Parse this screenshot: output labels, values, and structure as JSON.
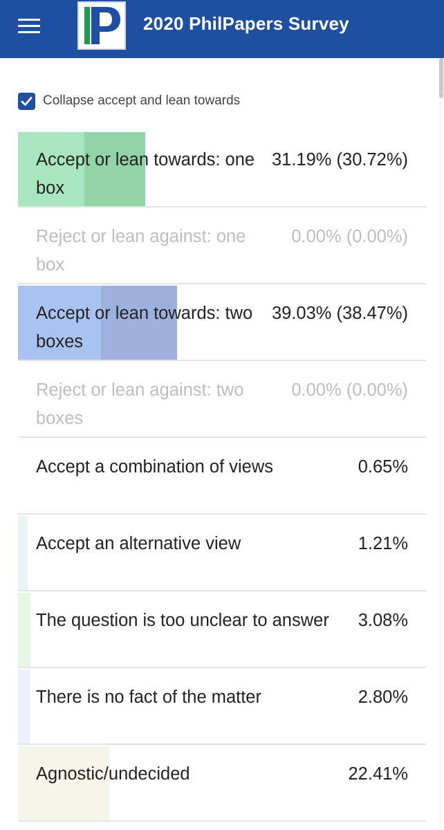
{
  "header": {
    "title": "2020 PhilPapers Survey",
    "logo_letter": "P",
    "background": "#1f4fa0"
  },
  "collapse": {
    "checked": true,
    "label": "Collapse accept and lean towards"
  },
  "results": [
    {
      "label": "Accept or lean towards: one box",
      "value": "31.19% (30.72%)",
      "percent": 31.19,
      "color": "#a8e6bf",
      "muted": false
    },
    {
      "label": "Reject or lean against: one box",
      "value": "0.00% (0.00%)",
      "percent": 0.0,
      "color": null,
      "muted": true
    },
    {
      "label": "Accept or lean towards: two boxes",
      "value": "39.03% (38.47%)",
      "percent": 39.03,
      "color": "#a9c3f0",
      "muted": false
    },
    {
      "label": "Reject or lean against: two boxes",
      "value": "0.00% (0.00%)",
      "percent": 0.0,
      "color": null,
      "muted": true
    },
    {
      "label": "Accept a combination of views",
      "value": "0.65%",
      "percent": 0.65,
      "color": null,
      "muted": false
    },
    {
      "label": "Accept an alternative view",
      "value": "1.21%",
      "percent": 1.21,
      "color": "#e6f6f4",
      "muted": false
    },
    {
      "label": "The question is too unclear to answer",
      "value": "3.08%",
      "percent": 3.08,
      "color": "#e6f6e3",
      "muted": false
    },
    {
      "label": "There is no fact of the matter",
      "value": "2.80%",
      "percent": 2.8,
      "color": "#ebf0fc",
      "muted": false
    },
    {
      "label": "Agnostic/undecided",
      "value": "22.41%",
      "percent": 22.41,
      "color": "#f5f5ea",
      "muted": false
    }
  ]
}
